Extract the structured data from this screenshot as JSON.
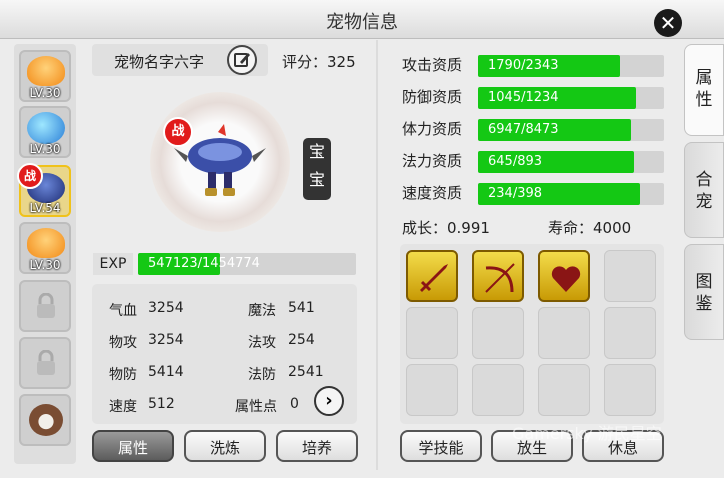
{
  "window": {
    "title": "宠物信息"
  },
  "pet_list": [
    {
      "level": "LV.30",
      "kind": "tiger"
    },
    {
      "level": "LV.30",
      "kind": "bird"
    },
    {
      "level": "LV.54",
      "kind": "blue",
      "badge": "战",
      "active": true
    },
    {
      "level": "LV.30",
      "kind": "tiger"
    }
  ],
  "pet": {
    "name": "宠物名字六字",
    "score_label": "评分：325",
    "battle_badge": "战",
    "baby_tag": "宝宝",
    "exp_label": "EXP",
    "exp_text": "547123/1454774",
    "exp_progress": 0.376
  },
  "stats": {
    "hp_label": "气血",
    "hp_value": "3254",
    "mp_label": "魔法",
    "mp_value": "541",
    "patk_label": "物攻",
    "patk_value": "3254",
    "matk_label": "法攻",
    "matk_value": "254",
    "pdef_label": "物防",
    "pdef_value": "5414",
    "mdef_label": "法防",
    "mdef_value": "2541",
    "spd_label": "速度",
    "spd_value": "512",
    "attr_label": "属性点",
    "attr_value": "0"
  },
  "bottom_left_buttons": {
    "attributes": "属性",
    "refine": "洗炼",
    "cultivate": "培养"
  },
  "aptitudes": [
    {
      "label": "攻击资质",
      "value": "1790/2343",
      "progress": 0.764
    },
    {
      "label": "防御资质",
      "value": "1045/1234",
      "progress": 0.847
    },
    {
      "label": "体力资质",
      "value": "6947/8473",
      "progress": 0.82
    },
    {
      "label": "法力资质",
      "value": "645/893",
      "progress": 0.84
    },
    {
      "label": "速度资质",
      "value": "234/398",
      "progress": 0.87
    }
  ],
  "growth_label": "成长：0.991",
  "lifespan_label": "寿命：4000",
  "skills": [
    "sword-icon",
    "bow-icon",
    "heart-icon"
  ],
  "bottom_right_buttons": {
    "learn": "学技能",
    "release": "放生",
    "rest": "休息"
  },
  "side_tabs": {
    "attributes": "属性",
    "merge": "合宠",
    "gallery": "图鉴"
  },
  "watermark": "Gamersky 游民星空"
}
